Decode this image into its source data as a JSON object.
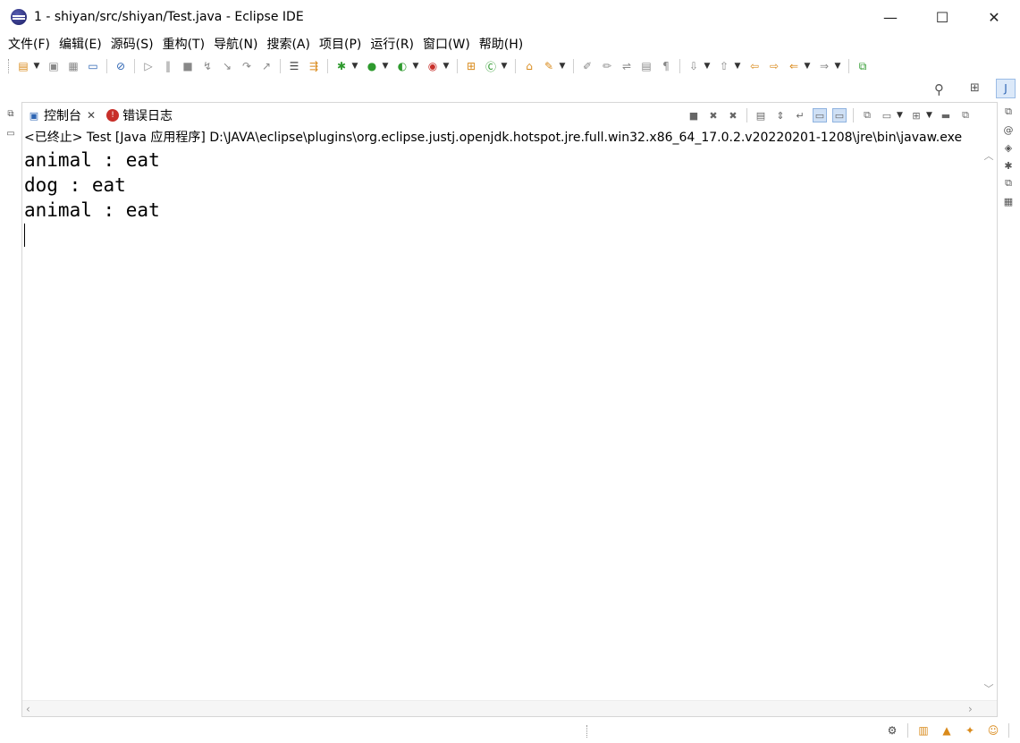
{
  "window": {
    "title": "1 - shiyan/src/shiyan/Test.java - Eclipse IDE",
    "minimize_glyph": "—",
    "maximize_glyph": "☐",
    "close_glyph": "✕"
  },
  "menu": [
    "文件(F)",
    "编辑(E)",
    "源码(S)",
    "重构(T)",
    "导航(N)",
    "搜索(A)",
    "项目(P)",
    "运行(R)",
    "窗口(W)",
    "帮助(H)"
  ],
  "console": {
    "tabs": [
      {
        "label": "控制台",
        "icon": "console-icon",
        "active": true
      },
      {
        "label": "错误日志",
        "icon": "error-log-icon",
        "active": false
      }
    ],
    "process_info": "<已终止> Test [Java 应用程序] D:\\JAVA\\eclipse\\plugins\\org.eclipse.justj.openjdk.hotspot.jre.full.win32.x86_64_17.0.2.v20220201-1208\\jre\\bin\\javaw.exe",
    "output_lines": [
      "animal : eat",
      "dog : eat",
      "animal : eat"
    ]
  },
  "colors": {
    "accent": "#2d64b3",
    "run": "#2e9a2e",
    "error": "#c8302a",
    "pressed_bg": "#cfe0f5"
  }
}
